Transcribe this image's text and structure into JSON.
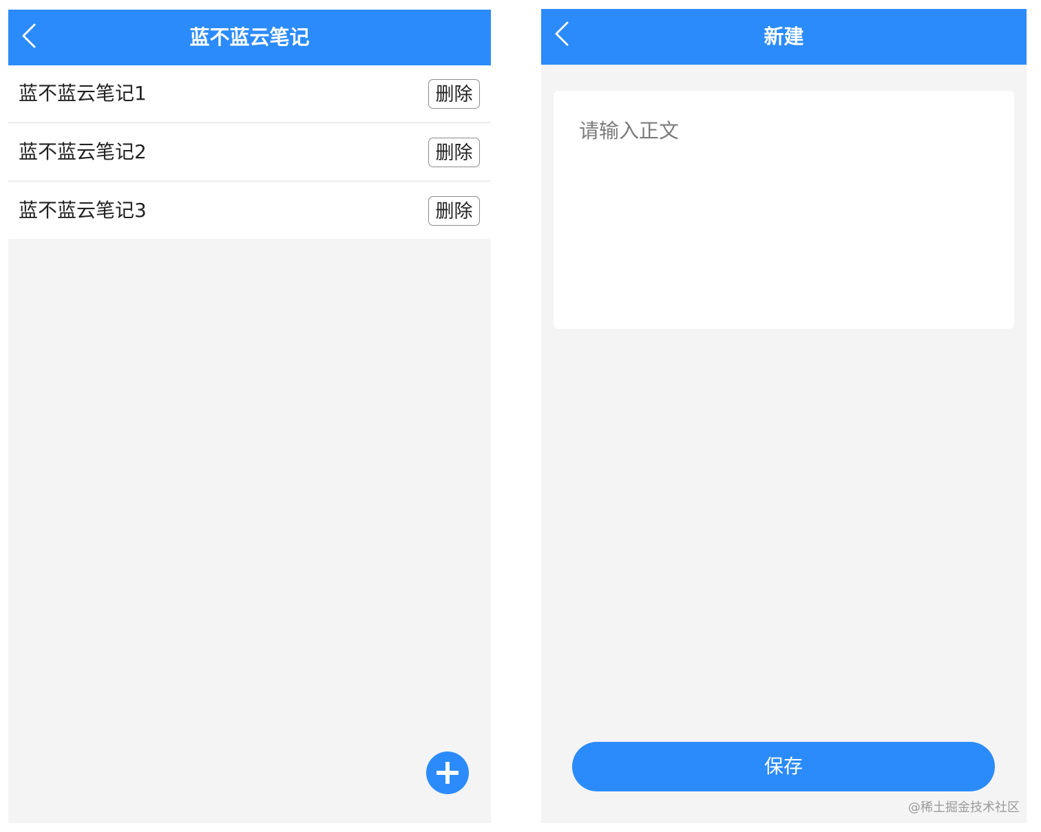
{
  "list_screen": {
    "title": "蓝不蓝云笔记",
    "back_icon": "chevron-left-icon",
    "notes": [
      {
        "title": "蓝不蓝云笔记1",
        "delete_label": "删除"
      },
      {
        "title": "蓝不蓝云笔记2",
        "delete_label": "删除"
      },
      {
        "title": "蓝不蓝云笔记3",
        "delete_label": "删除"
      }
    ],
    "add_icon": "plus-icon"
  },
  "new_screen": {
    "title": "新建",
    "back_icon": "chevron-left-icon",
    "editor": {
      "placeholder": "请输入正文",
      "value": ""
    },
    "save_label": "保存"
  },
  "watermark": "@稀土掘金技术社区",
  "colors": {
    "accent": "#2b8bfa",
    "background": "#f4f4f5",
    "surface": "#ffffff"
  }
}
